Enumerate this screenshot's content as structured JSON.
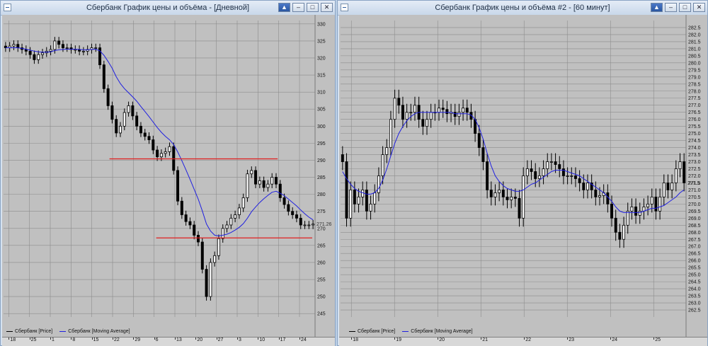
{
  "colors": {
    "candle": "#000000",
    "ma": "#2020e0",
    "support": "#e02020",
    "grid": "#8c8c8c",
    "plot_bg": "#c0c0c0"
  },
  "windows": [
    {
      "title": "Сбербанк График цены и объёма - [Дневной]",
      "legend": {
        "price": "Сбербанк [Price]",
        "ma": "Сбербанк [Moving Average]"
      },
      "x_labels": [
        "18",
        "25",
        "1",
        "8",
        "15",
        "22",
        "29",
        "6",
        "13",
        "20",
        "27",
        "3",
        "10",
        "17",
        "24"
      ],
      "last_price_label": "271.26",
      "chart_data": {
        "type": "line",
        "title": "",
        "ylim": [
          244,
          331
        ],
        "y_ticks": [
          245,
          250,
          255,
          260,
          265,
          270,
          275,
          280,
          285,
          290,
          295,
          300,
          305,
          310,
          315,
          320,
          325,
          330
        ],
        "series": [
          {
            "name": "Сбербанк [Price]",
            "values": [
              323,
              323.5,
              324,
              323,
              322.5,
              322,
              321,
              319.5,
              321,
              321.5,
              322,
              322.5,
              325,
              324,
              323,
              323,
              322.5,
              322.5,
              322,
              322,
              322.5,
              323,
              323,
              318,
              311,
              306,
              302,
              298,
              300,
              304,
              306,
              303,
              300,
              298,
              297,
              296,
              293,
              291,
              292,
              292.5,
              294,
              287,
              278,
              274,
              272,
              271,
              268,
              266,
              258,
              250,
              260,
              262,
              267,
              270,
              271,
              273,
              274,
              276,
              279,
              286,
              287,
              283,
              284,
              282,
              283,
              285,
              283,
              279,
              277,
              275,
              274,
              273,
              271,
              271,
              271,
              271.26
            ]
          },
          {
            "name": "Сбербанк [Moving Average]",
            "values": [
              323,
              323,
              323,
              323,
              322.8,
              322.6,
              322.3,
              322,
              321.8,
              321.7,
              321.7,
              321.8,
              322.2,
              322.4,
              322.5,
              322.6,
              322.6,
              322.6,
              322.5,
              322.4,
              322.4,
              322.5,
              322.6,
              322.1,
              320.8,
              319,
              317,
              314.5,
              312.5,
              311,
              309.8,
              308.6,
              307.3,
              305.8,
              304.3,
              302.8,
              301.2,
              299.6,
              298.2,
              297,
              296,
              294.6,
              292.4,
              289.9,
              287.2,
              284.4,
              281.5,
              278.6,
              275.1,
              271.3,
              269.2,
              268,
              267.8,
              268,
              268.3,
              268.8,
              269.5,
              270.3,
              271.4,
              273,
              274.9,
              276.3,
              277.6,
              278.7,
              279.7,
              280.6,
              280.9,
              280.3,
              279.6,
              278.6,
              277.6,
              276.6,
              275.4,
              274.3,
              273.3,
              272.5
            ]
          }
        ],
        "levels": [
          290.4,
          267.2
        ]
      }
    },
    {
      "title": "Сбербанк График цены и объёма #2 - [60 минут]",
      "legend": {
        "price": "Сбербанк [Price]",
        "ma": "Сбербанк [Moving Average]"
      },
      "x_labels": [
        "18",
        "19",
        "20",
        "21",
        "22",
        "23",
        "24",
        "25"
      ],
      "last_price_label": "271.5",
      "chart_data": {
        "type": "line",
        "title": "",
        "ylim": [
          262.0,
          283.0
        ],
        "y_ticks": [
          262.5,
          263.0,
          263.5,
          264.0,
          264.5,
          265.0,
          265.5,
          266.0,
          266.5,
          267.0,
          267.5,
          268.0,
          268.5,
          269.0,
          269.5,
          270.0,
          270.5,
          271.0,
          271.5,
          272.0,
          272.5,
          273.0,
          273.5,
          274.0,
          274.5,
          275.0,
          275.5,
          276.0,
          276.5,
          277.0,
          277.5,
          278.0,
          278.5,
          279.0,
          279.5,
          280.0,
          280.5,
          281.0,
          281.5,
          282.0,
          282.5
        ],
        "series": [
          {
            "name": "Сбербанк [Price]",
            "values": [
              273,
              269,
              271,
              270,
              270.5,
              271,
              269.5,
              270,
              270.8,
              272,
              273.5,
              274,
              276,
              277.5,
              277,
              276,
              276.5,
              276.5,
              277,
              276,
              275.5,
              276,
              276.5,
              276.5,
              276.8,
              276.7,
              276.4,
              276.5,
              276.2,
              276.5,
              276.8,
              276.5,
              276,
              275,
              274,
              273,
              271,
              270.5,
              270.8,
              271,
              270.5,
              270.3,
              270.5,
              270.4,
              269,
              272,
              272.5,
              272.3,
              271.8,
              272,
              272.5,
              273,
              273,
              272.8,
              272.5,
              272,
              272,
              272,
              271.8,
              271.5,
              271,
              271.5,
              271,
              270.5,
              270.6,
              270.8,
              270,
              269,
              268,
              267.5,
              268.5,
              269.5,
              269.8,
              269.2,
              269.5,
              269.8,
              270,
              270.5,
              269.5,
              270.5,
              271.5,
              271,
              271.5,
              272.5,
              273,
              271.5
            ]
          },
          {
            "name": "Сбербанк [Moving Average]",
            "values": [
              272.3,
              271.8,
              271.4,
              271.1,
              270.9,
              270.8,
              270.7,
              270.7,
              270.8,
              271.1,
              271.7,
              272.5,
              273.4,
              274.3,
              275,
              275.5,
              275.9,
              276.2,
              276.4,
              276.5,
              276.5,
              276.5,
              276.5,
              276.5,
              276.5,
              276.5,
              276.5,
              276.5,
              276.4,
              276.4,
              276.4,
              276.4,
              276.3,
              276,
              275.4,
              274.6,
              273.6,
              272.7,
              272,
              271.6,
              271.3,
              271.1,
              271,
              270.9,
              270.9,
              271,
              271.2,
              271.4,
              271.5,
              271.7,
              271.9,
              272.1,
              272.3,
              272.4,
              272.4,
              272.4,
              272.3,
              272.2,
              272.1,
              272,
              271.8,
              271.6,
              271.4,
              271.2,
              271,
              270.8,
              270.5,
              270.2,
              269.8,
              269.5,
              269.4,
              269.4,
              269.4,
              269.4,
              269.4,
              269.5,
              269.6,
              269.7,
              269.7,
              269.8,
              269.9,
              270.1,
              270.3,
              270.5,
              270.8,
              271
            ]
          }
        ],
        "levels": []
      }
    }
  ]
}
